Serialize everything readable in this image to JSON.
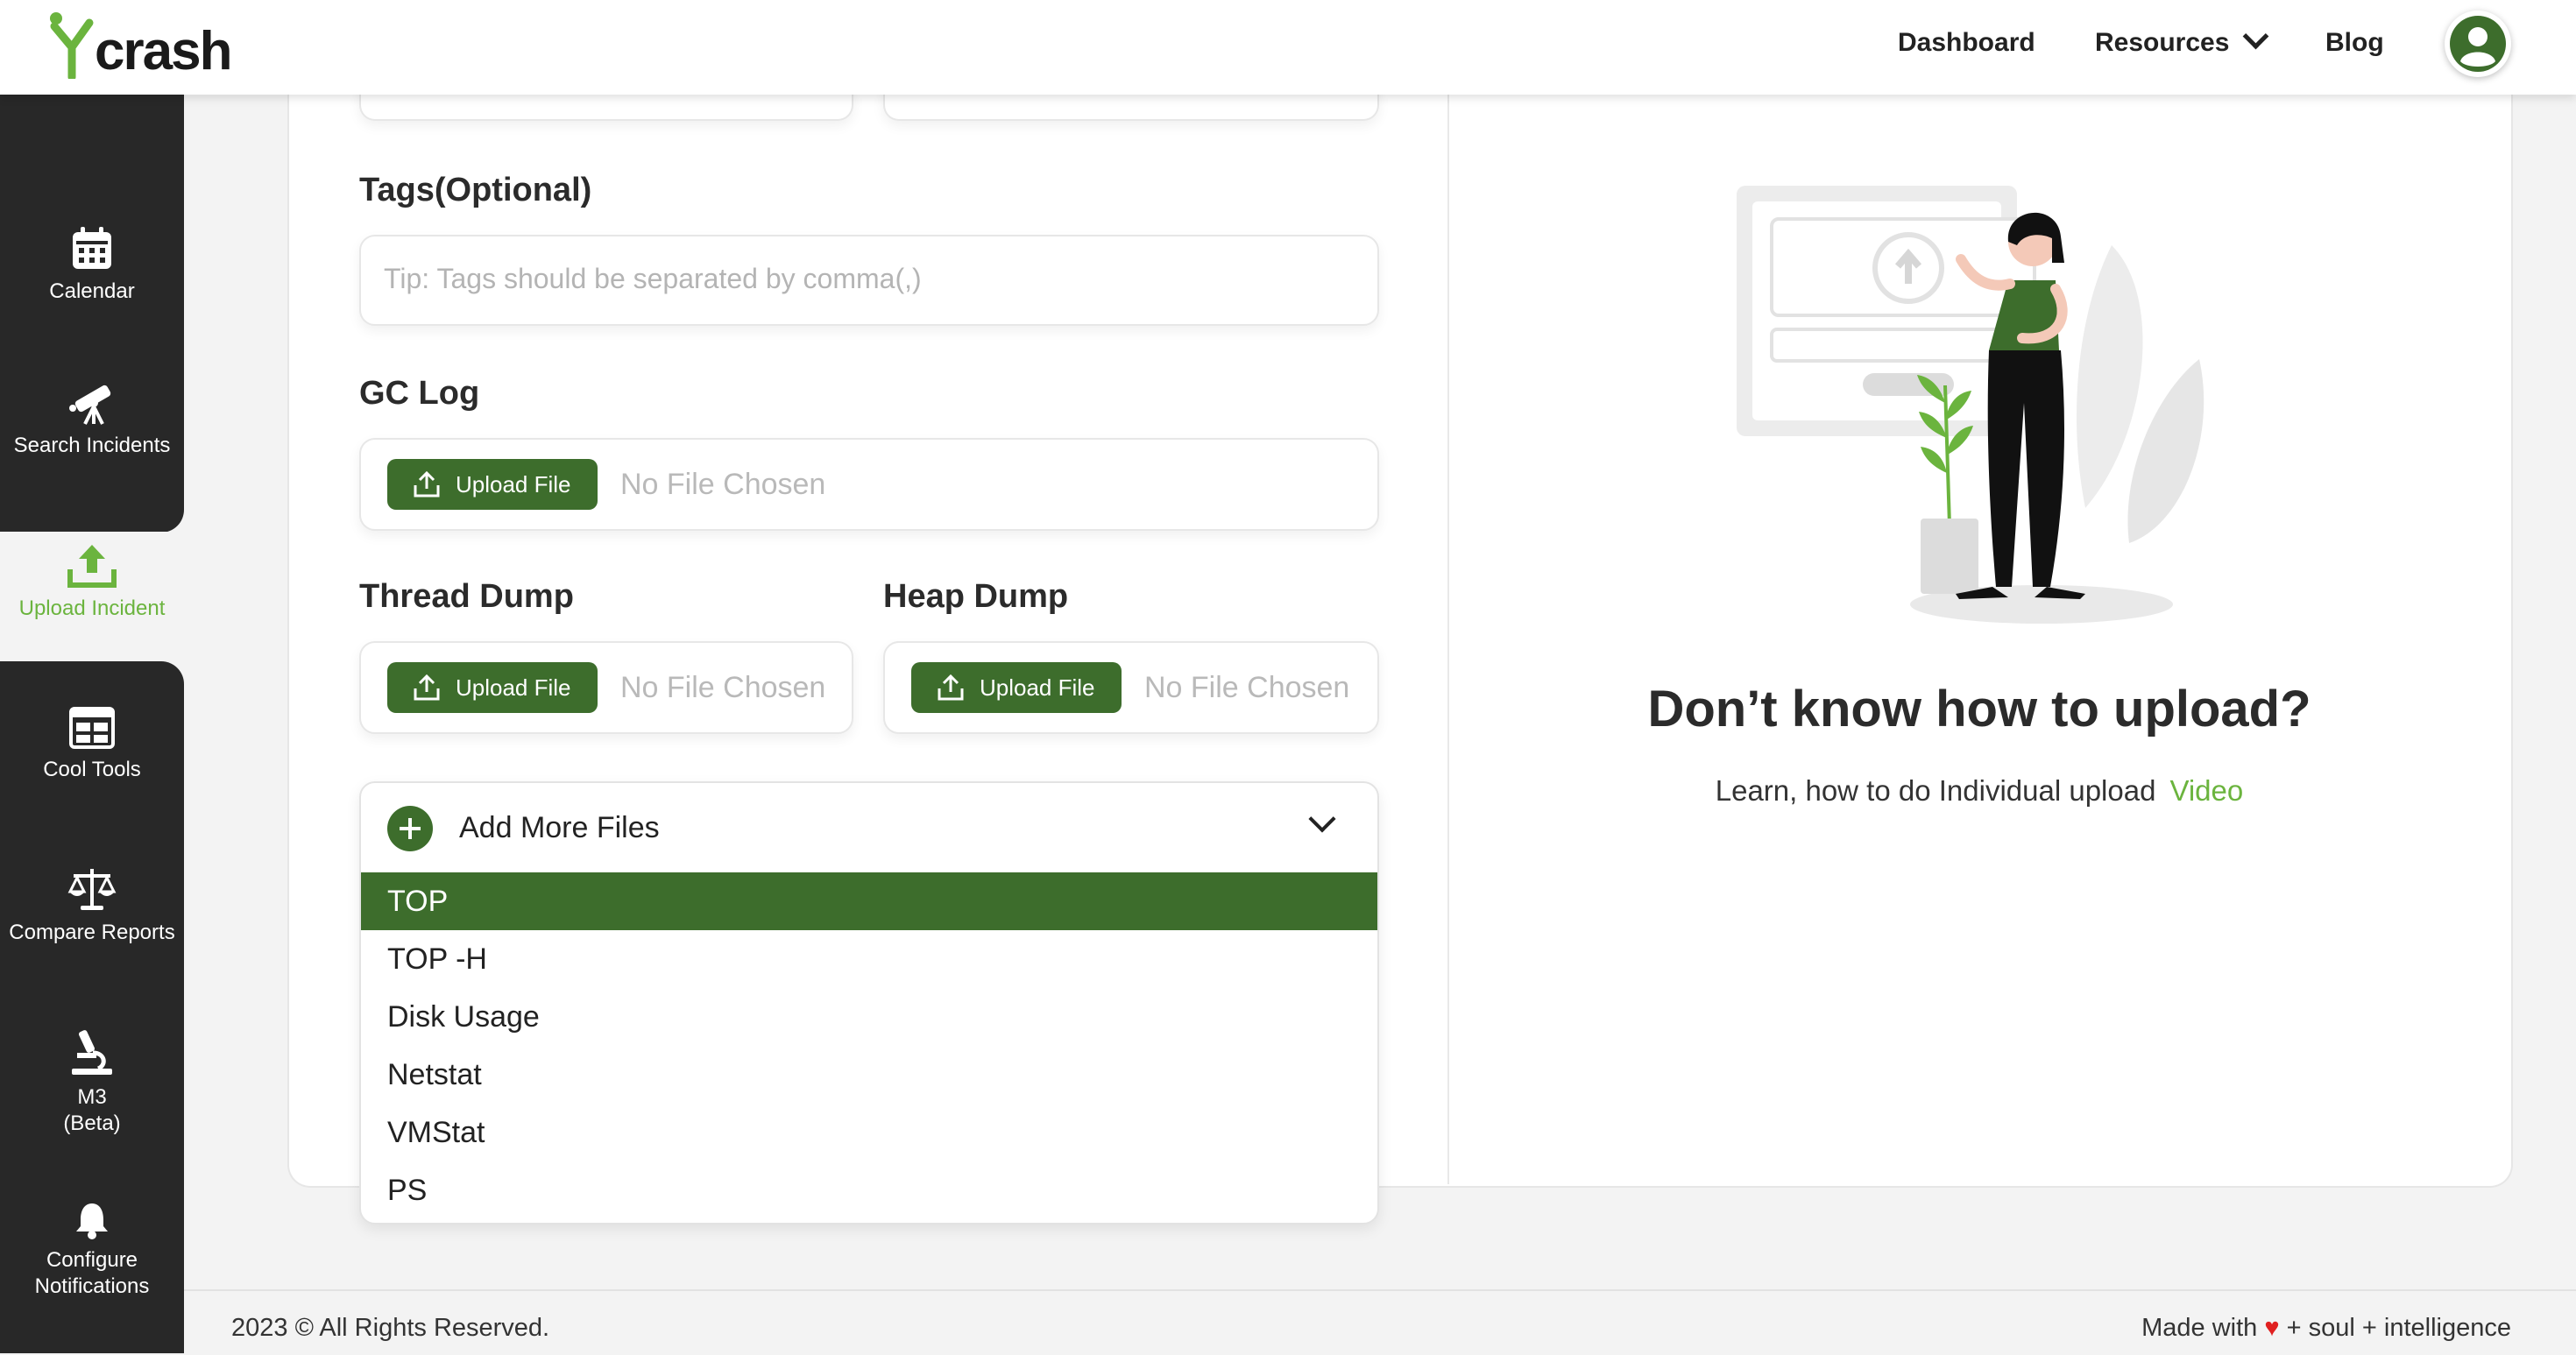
{
  "header": {
    "logo_text": "crash",
    "nav": [
      {
        "label": "Dashboard"
      },
      {
        "label": "Resources"
      },
      {
        "label": "Blog"
      }
    ]
  },
  "sidebar": {
    "items": [
      {
        "label": "Calendar",
        "icon": "calendar-icon"
      },
      {
        "label": "Search Incidents",
        "icon": "telescope-icon"
      },
      {
        "label": "Upload Incident",
        "icon": "upload-icon",
        "active": true
      },
      {
        "label": "Cool Tools",
        "icon": "tools-icon"
      },
      {
        "label": "Compare Reports",
        "icon": "scales-icon"
      },
      {
        "label": "M3 (Beta)",
        "icon": "microscope-icon"
      },
      {
        "label": "Configure Notifications",
        "icon": "bell-icon"
      }
    ]
  },
  "form": {
    "tags": {
      "label": "Tags(Optional)",
      "placeholder": "Tip: Tags should be separated by comma(,)"
    },
    "gc_log": {
      "label": "GC Log",
      "button": "Upload File",
      "status": "No File Chosen"
    },
    "thread_dump": {
      "label": "Thread Dump",
      "button": "Upload File",
      "status": "No File Chosen"
    },
    "heap_dump": {
      "label": "Heap Dump",
      "button": "Upload File",
      "status": "No File Chosen"
    },
    "add_more": {
      "label": "Add More Files",
      "options": [
        "TOP",
        "TOP -H",
        "Disk Usage",
        "Netstat",
        "VMStat",
        "PS"
      ],
      "selected": "TOP"
    }
  },
  "help": {
    "title": "Don’t know how to upload?",
    "subtitle": "Learn, how to do Individual upload",
    "link": "Video"
  },
  "footer": {
    "copyright": "2023 © All Rights Reserved.",
    "made_with_prefix": "Made with",
    "made_with_suffix": "+ soul + intelligence"
  },
  "colors": {
    "accent": "#3d6d2c",
    "accent_light": "#6bb43e",
    "sidebar": "#282828"
  }
}
